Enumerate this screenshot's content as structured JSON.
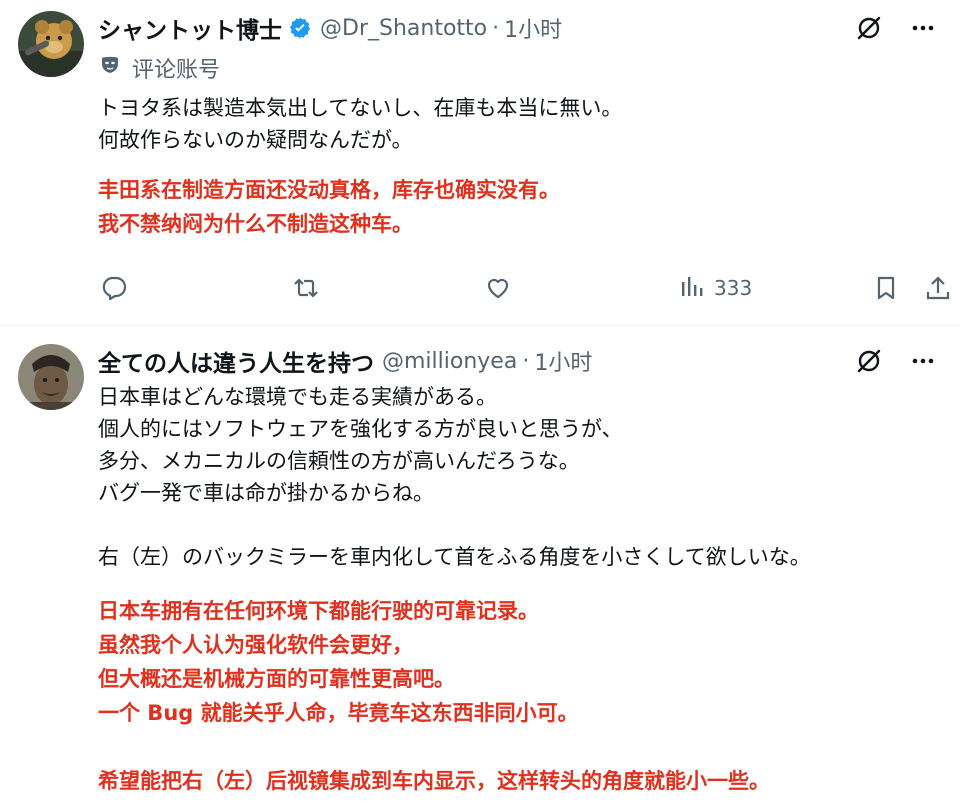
{
  "tweets": [
    {
      "display_name": "シャントット博士",
      "handle": "@Dr_Shantotto",
      "separator": "·",
      "time": "1小时",
      "sub_label": "评论账号",
      "text_lines": [
        "トヨタ系は製造本気出してないし、在庫も本当に無い。",
        "何故作らないのか疑問なんだが。"
      ],
      "translation_lines": [
        "丰田系在制造方面还没动真格，库存也确实没有。",
        "我不禁纳闷为什么不制造这种车。"
      ],
      "views": "333"
    },
    {
      "display_name": "全ての人は違う人生を持つ",
      "handle": "@millionyea",
      "separator": "·",
      "time": "1小时",
      "text_lines": [
        "日本車はどんな環境でも走る実績がある。",
        "個人的にはソフトウェアを強化する方が良いと思うが、",
        "多分、メカニカルの信頼性の方が高いんだろうな。",
        "バグ一発で車は命が掛かるからね。",
        "",
        "右（左）のバックミラーを車内化して首をふる角度を小さくして欲しいな。"
      ],
      "translation_lines": [
        "日本车拥有在任何环境下都能行驶的可靠记录。",
        "虽然我个人认为强化软件会更好，",
        "但大概还是机械方面的可靠性更高吧。",
        "一个 Bug 就能关乎人命，毕竟车这东西非同小可。",
        "",
        "希望能把右（左）后视镜集成到车内显示，这样转头的角度就能小一些。"
      ]
    }
  ],
  "colors": {
    "verified": "#1d9bf0",
    "translation": "#e0301e",
    "secondary_text": "#536471"
  },
  "icons": {
    "grok": "grok-icon",
    "more": "more-icon",
    "reply": "reply-icon",
    "retweet": "retweet-icon",
    "like": "like-icon",
    "views": "views-icon",
    "bookmark": "bookmark-icon",
    "share": "share-icon"
  }
}
